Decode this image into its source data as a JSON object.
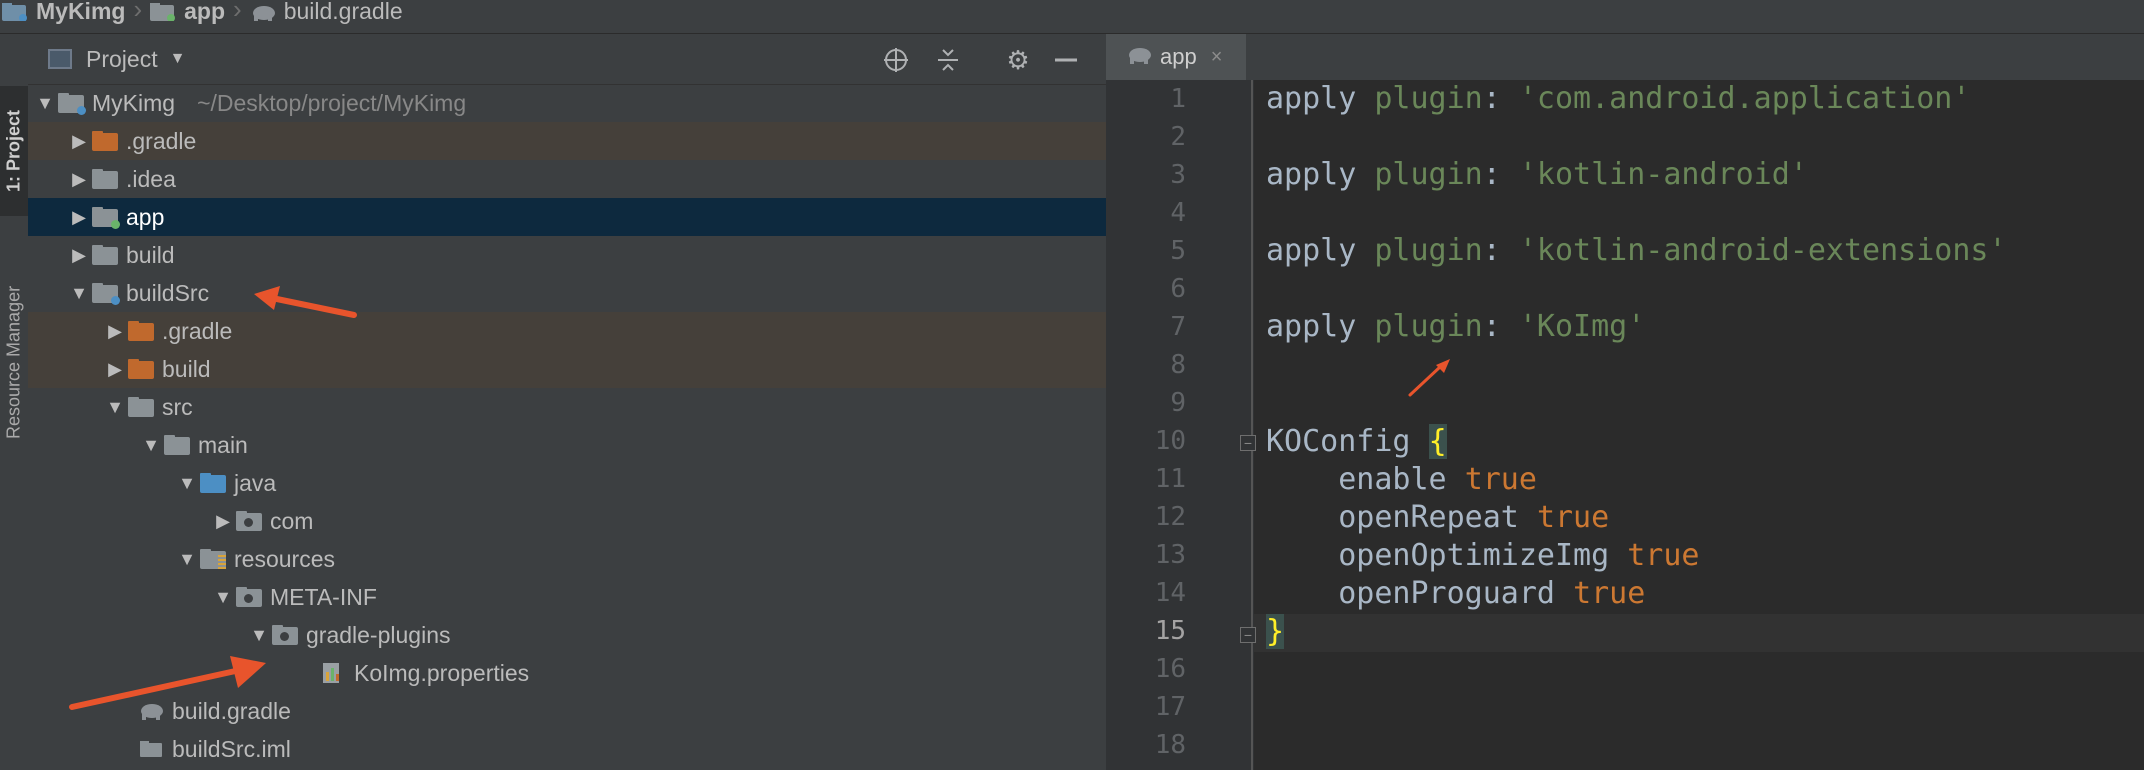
{
  "breadcrumb": {
    "items": [
      {
        "label": "MyKimg",
        "icon": "module-folder-icon"
      },
      {
        "label": "app",
        "icon": "module-folder-icon"
      },
      {
        "label": "build.gradle",
        "icon": "gradle-elephant-icon"
      }
    ]
  },
  "side_tabs": {
    "project": "1: Project",
    "resource_manager": "Resource Manager"
  },
  "project_panel": {
    "title": "Project",
    "icons": [
      "locate-icon",
      "collapse-all-icon",
      "gear-icon",
      "minimize-icon"
    ]
  },
  "tree": [
    {
      "label": "MyKimg",
      "path": "~/Desktop/project/MyKimg",
      "expanded": true,
      "icon": "module-folder-icon"
    },
    {
      "label": ".gradle",
      "expanded": false,
      "icon": "excluded-folder-icon"
    },
    {
      "label": ".idea",
      "expanded": false,
      "icon": "folder-icon"
    },
    {
      "label": "app",
      "expanded": false,
      "icon": "module-folder-icon",
      "selected": true
    },
    {
      "label": "build",
      "expanded": false,
      "icon": "folder-icon"
    },
    {
      "label": "buildSrc",
      "expanded": true,
      "icon": "module-folder-icon"
    },
    {
      "label": ".gradle",
      "expanded": false,
      "icon": "excluded-folder-icon"
    },
    {
      "label": "build",
      "expanded": false,
      "icon": "excluded-folder-icon"
    },
    {
      "label": "src",
      "expanded": true,
      "icon": "folder-icon"
    },
    {
      "label": "main",
      "expanded": true,
      "icon": "folder-icon"
    },
    {
      "label": "java",
      "expanded": true,
      "icon": "source-folder-icon"
    },
    {
      "label": "com",
      "expanded": false,
      "icon": "package-icon"
    },
    {
      "label": "resources",
      "expanded": true,
      "icon": "resources-folder-icon"
    },
    {
      "label": "META-INF",
      "expanded": true,
      "icon": "package-icon"
    },
    {
      "label": "gradle-plugins",
      "expanded": true,
      "icon": "package-icon"
    },
    {
      "label": "KoImg.properties",
      "icon": "properties-file-icon"
    },
    {
      "label": "build.gradle",
      "icon": "gradle-elephant-icon"
    },
    {
      "label": "buildSrc.iml",
      "icon": "iml-file-icon"
    }
  ],
  "editor": {
    "tab_label": "app",
    "tab_close": "×",
    "current_line": 15,
    "line_numbers": [
      "1",
      "2",
      "3",
      "4",
      "5",
      "6",
      "7",
      "8",
      "9",
      "10",
      "11",
      "12",
      "13",
      "14",
      "15",
      "16",
      "17",
      "18"
    ],
    "code": {
      "l1_kw": "apply",
      "l1_plugin": "plugin",
      "l1_colon": ":",
      "l1_str": "'com.android.application'",
      "l3_kw": "apply",
      "l3_plugin": "plugin",
      "l3_colon": ":",
      "l3_str": "'kotlin-android'",
      "l5_kw": "apply",
      "l5_plugin": "plugin",
      "l5_colon": ":",
      "l5_str": "'kotlin-android-extensions'",
      "l7_kw": "apply",
      "l7_plugin": "plugin",
      "l7_colon": ":",
      "l7_str": "'KoImg'",
      "l10_name": "KOConfig",
      "l10_brace": "{",
      "l11_key": "enable",
      "l11_val": "true",
      "l12_key": "openRepeat",
      "l12_val": "true",
      "l13_key": "openOptimizeImg",
      "l13_val": "true",
      "l14_key": "openProguard",
      "l14_val": "true",
      "l15_brace": "}"
    }
  },
  "colors": {
    "annotation_arrow": "#e8542c",
    "selection": "#0d293e",
    "excluded_highlight": "#45403a"
  }
}
